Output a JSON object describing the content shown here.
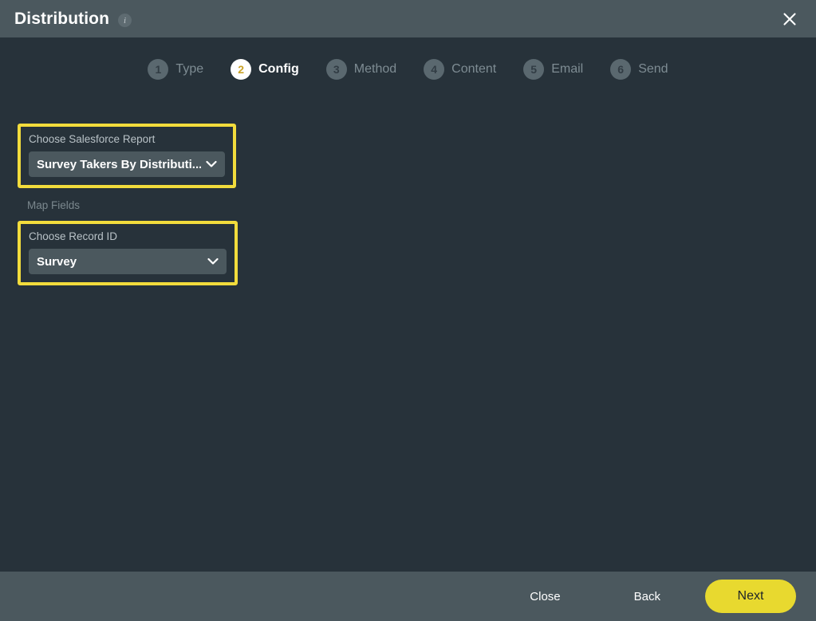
{
  "header": {
    "title": "Distribution",
    "info_icon": "info-icon",
    "close_icon": "close-icon"
  },
  "stepper": {
    "steps": [
      {
        "number": "1",
        "label": "Type",
        "active": false
      },
      {
        "number": "2",
        "label": "Config",
        "active": true
      },
      {
        "number": "3",
        "label": "Method",
        "active": false
      },
      {
        "number": "4",
        "label": "Content",
        "active": false
      },
      {
        "number": "5",
        "label": "Email",
        "active": false
      },
      {
        "number": "6",
        "label": "Send",
        "active": false
      }
    ]
  },
  "form": {
    "report_field": {
      "label": "Choose Salesforce Report",
      "value": "Survey Takers By Distributi...",
      "chevron_icon": "chevron-down-icon",
      "highlighted": true
    },
    "map_fields_label": "Map Fields",
    "record_id_field": {
      "label": "Choose Record ID",
      "value": "Survey",
      "chevron_icon": "chevron-down-icon",
      "highlighted": true
    }
  },
  "footer": {
    "close_label": "Close",
    "back_label": "Back",
    "next_label": "Next"
  },
  "colors": {
    "background": "#27323a",
    "bar": "#4b585e",
    "highlight": "#f2dc3c",
    "primary": "#e8d92f",
    "muted_text": "#7e8c93"
  }
}
